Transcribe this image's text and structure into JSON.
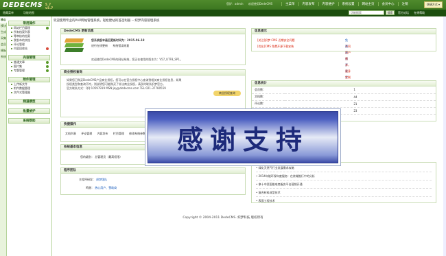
{
  "header": {
    "logo": "DEDECMS",
    "version_top": "5.7",
    "version_bottom": "v5.7",
    "user_links": [
      "您好：admin",
      "欢迎使用DedeCMS"
    ],
    "nav": [
      "主菜单",
      "内容发布",
      "内容维护",
      "系统设置",
      "网站主页",
      "会员中心",
      "注销"
    ],
    "fast_button": "快捷方式 ▾"
  },
  "subbar": {
    "label1": "隐藏菜单",
    "label2": "功能地图",
    "search_value": "功能搜索",
    "search_button": "搜索",
    "links": [
      "官方论坛",
      "在线帮助"
    ]
  },
  "left_tabs": [
    "核心",
    "模块",
    "生成",
    "采集",
    "会员",
    "模板",
    "系统"
  ],
  "menu": {
    "groups": [
      {
        "title": "常用操作",
        "items": [
          {
            "label": "网站栏目管理",
            "add": true
          },
          {
            "label": "所有档案列表",
            "add": false
          },
          {
            "label": "等审核的档案",
            "add": false
          },
          {
            "label": "我发布的文档",
            "add": false
          },
          {
            "label": "评论管理",
            "add": false
          },
          {
            "label": "内容回收站",
            "add": true,
            "red": true
          }
        ]
      },
      {
        "title": "内容管理",
        "items": [
          {
            "label": "普通文章",
            "add": true
          },
          {
            "label": "图片集",
            "add": true
          },
          {
            "label": "专题管理",
            "add": true
          }
        ]
      },
      {
        "title": "附件管理",
        "items": [
          {
            "label": "上传新文件",
            "add": false
          },
          {
            "label": "附件数据管理",
            "add": false
          },
          {
            "label": "文件式管理器",
            "add": false
          }
        ]
      },
      {
        "title": "频道模型",
        "items": []
      },
      {
        "title": "批量维护",
        "items": []
      },
      {
        "title": "系统帮助",
        "items": []
      }
    ]
  },
  "breadcrumb": "欢迎使用专业的PHP网站管理系统，轻松建站的首选利器 -- 织梦内容管理系统",
  "update_panel": {
    "title": "DedeCMS 更新消息",
    "heading": "您系统版本最后更新时间为：2015-06-18",
    "btn1": "进行在线更新",
    "btn2": "系统错误修复",
    "welcome": "欢迎使用DedeCMS的网站系统，您正在使用的版本为：V57_UTF8_SP1。"
  },
  "license_panel": {
    "title": "商业授权查询",
    "lines": [
      "如果您已购买DedeCMS产品商业授权，您可以在官方授权中心查询到相关商业授权信息，如果",
      "授权类型和查询不符，则说明您可能购买了非法商业授权，请及时联系织梦官方。",
      "官方联系方式：QQ:10597919 MSN:jay@dedecms.com TEL:021-37780559"
    ],
    "button": "商业授权查询"
  },
  "quick_panel": {
    "title": "快捷操作",
    "items": [
      "文档列表",
      "评论管理",
      "内容发布",
      "栏目管理",
      "修改系统参数"
    ]
  },
  "sysinfo_panel": {
    "title": "系统基本信息",
    "label": "您的级别：",
    "value": "总管理员（最高权限）"
  },
  "team_panel": {
    "title": "程序团队",
    "row1_label": "主程序研发：",
    "row1_value": "织梦团队",
    "row2_label": "鸣谢：",
    "row2_value": "热心用户、赞助商"
  },
  "notice_panel": {
    "title": "信息提示",
    "links": [
      {
        "a": "[关注]织梦 CMS 近期安全问题",
        "b": "免费原创开发平台 开业送好礼"
      },
      {
        "a": "[优化]CMS 免费开源下载安装",
        "b": "不同用户需求，量身定制服务"
      }
    ]
  },
  "stats_panel": {
    "title": "信息统计",
    "rows": [
      {
        "label": "会员数：",
        "value": "1"
      },
      {
        "label": "文档数：",
        "value": "44"
      },
      {
        "label": "评论数：",
        "value": "21"
      },
      {
        "label": "专题数：",
        "value": "23"
      }
    ]
  },
  "news_panel": {
    "items": [
      "绿化天然气行业发展需求攻略",
      "2014年能环保年度服务：在终端推行中的分析",
      "拿十中资国推电商服务平台营销开通",
      "复合材料成型技术",
      "表面工程技术"
    ]
  },
  "overlay": {
    "text": "感谢支持"
  },
  "copyright": "Copyright © 2004-2011 DedeCMS. 织梦科技 版权所有"
}
